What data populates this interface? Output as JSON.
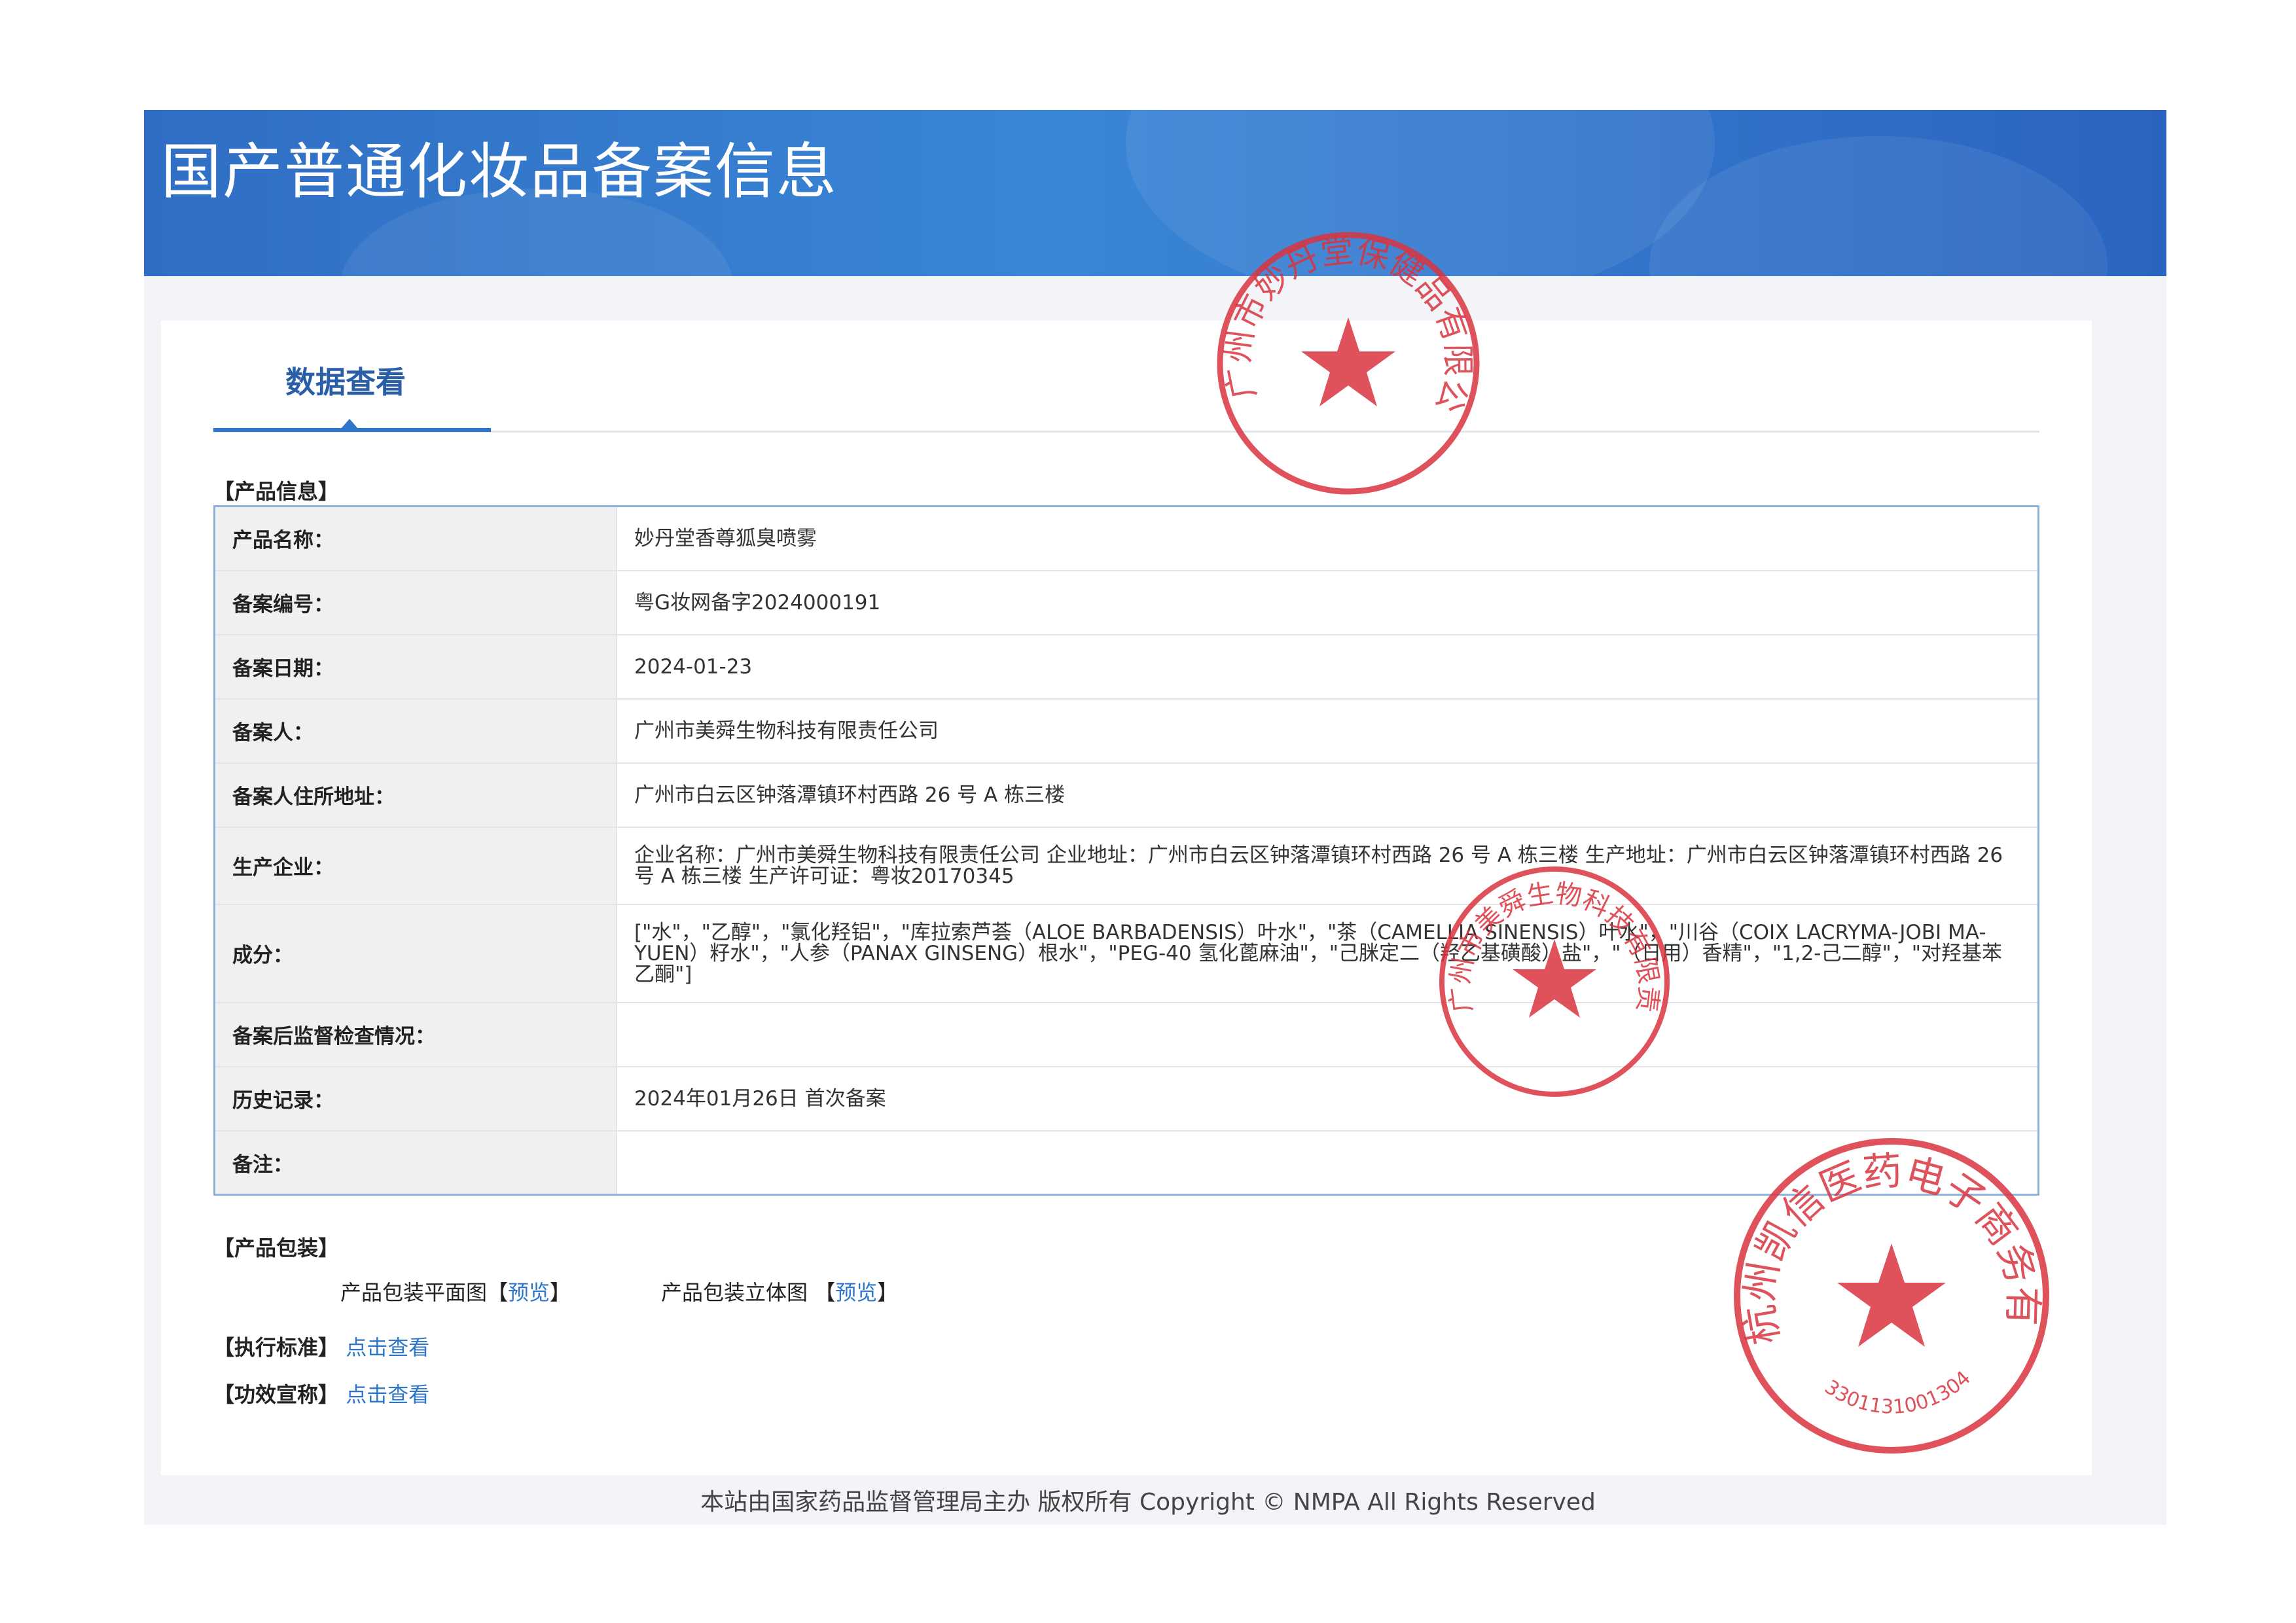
{
  "page": {
    "title": "国产普通化妆品备案信息"
  },
  "tab": {
    "label": "数据查看"
  },
  "product_section": {
    "heading": "【产品信息】"
  },
  "product_info": [
    {
      "key": "产品名称：",
      "value": "妙丹堂香尊狐臭喷雾"
    },
    {
      "key": "备案编号：",
      "value": "粤G妆网备字2024000191"
    },
    {
      "key": "备案日期：",
      "value": "2024-01-23"
    },
    {
      "key": "备案人：",
      "value": "广州市美舜生物科技有限责任公司"
    },
    {
      "key": "备案人住所地址：",
      "value": "广州市白云区钟落潭镇环村西路 26 号 A 栋三楼"
    },
    {
      "key": "生产企业：",
      "value": "企业名称：广州市美舜生物科技有限责任公司 企业地址：广州市白云区钟落潭镇环村西路 26 号 A 栋三楼 生产地址：广州市白云区钟落潭镇环村西路 26 号 A 栋三楼 生产许可证：粤妆20170345"
    },
    {
      "key": "成分：",
      "value": "[\"水\"，\"乙醇\"，\"氯化羟铝\"，\"库拉索芦荟（ALOE BARBADENSIS）叶水\"，\"茶（CAMELLIA SINENSIS）叶水\"，\"川谷（COIX LACRYMA-JOBI MA-YUEN）籽水\"，\"人参（PANAX GINSENG）根水\"，\"PEG-40 氢化蓖麻油\"，\"己脒定二（羟乙基磺酸）盐\"，\"（日用）香精\"，\"1,2-己二醇\"，\"对羟基苯乙酮\"]"
    },
    {
      "key": "备案后监督检查情况：",
      "value": ""
    },
    {
      "key": "历史记录：",
      "value": "2024年01月26日 首次备案"
    },
    {
      "key": "备注：",
      "value": ""
    }
  ],
  "packaging": {
    "heading": "【产品包装】",
    "flat_label": "产品包装平面图",
    "stereo_label": "产品包装立体图",
    "bracket_open": "【",
    "bracket_close": "】",
    "preview_link": "预览"
  },
  "standard": {
    "heading": "【执行标准】",
    "link": "点击查看"
  },
  "efficacy": {
    "heading": "【功效宣称】",
    "link": "点击查看"
  },
  "footer": {
    "text": "本站由国家药品监督管理局主办 版权所有 Copyright © NMPA All Rights Reserved"
  },
  "stamps": [
    {
      "name": "广州市妙丹堂保健品有限公司",
      "color": "#d9343f"
    },
    {
      "name": "广州市美舜生物科技有限责任公司",
      "color": "#d9343f"
    },
    {
      "name": "杭州凯信医药电子商务有限公司",
      "number": "3301131001304б",
      "color": "#d9343f"
    }
  ]
}
